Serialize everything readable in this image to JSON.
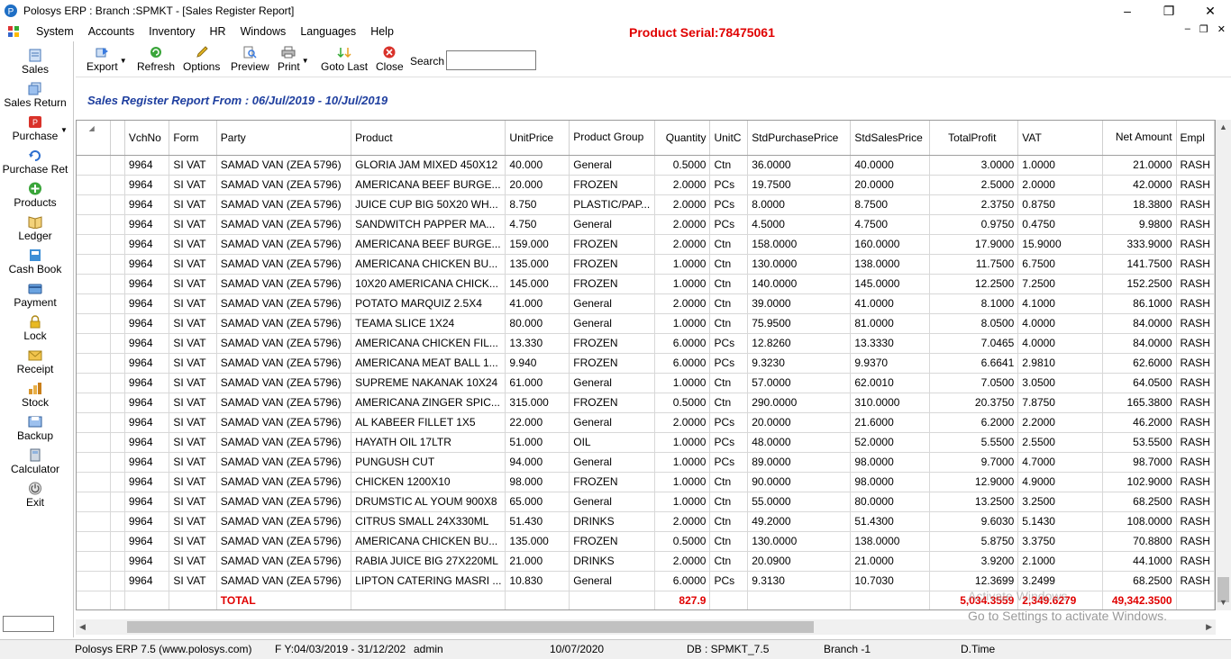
{
  "window": {
    "title": "Polosys ERP :  Branch :SPMKT  - [Sales Register Report]",
    "minimize": "–",
    "restore": "❐",
    "close": "✕"
  },
  "menu": [
    "System",
    "Accounts",
    "Inventory",
    "HR",
    "Windows",
    "Languages",
    "Help"
  ],
  "product_serial": "Product Serial:78475061",
  "mdi_controls": [
    "–",
    "❐",
    "✕"
  ],
  "sidebar": [
    {
      "label": "Sales",
      "icon": "sales-icon"
    },
    {
      "label": "Sales Return",
      "icon": "sales-return-icon"
    },
    {
      "label": "Purchase",
      "icon": "purchase-icon"
    },
    {
      "label": "Purchase Ret",
      "icon": "purchase-return-icon"
    },
    {
      "label": "Products",
      "icon": "products-icon"
    },
    {
      "label": "Ledger",
      "icon": "ledger-icon"
    },
    {
      "label": "Cash Book",
      "icon": "cash-book-icon"
    },
    {
      "label": "Payment",
      "icon": "payment-icon"
    },
    {
      "label": "Lock",
      "icon": "lock-icon"
    },
    {
      "label": "Receipt",
      "icon": "receipt-icon"
    },
    {
      "label": "Stock",
      "icon": "stock-icon"
    },
    {
      "label": "Backup",
      "icon": "backup-icon"
    },
    {
      "label": "Calculator",
      "icon": "calculator-icon"
    },
    {
      "label": "Exit",
      "icon": "exit-icon"
    }
  ],
  "toolbar": {
    "export": "Export",
    "refresh": "Refresh",
    "options": "Options",
    "preview": "Preview",
    "print": "Print",
    "goto_last": "Goto Last",
    "close": "Close",
    "search_label": "Search",
    "search_value": ""
  },
  "report_title": "Sales Register Report  From : 06/Jul/2019 - 10/Jul/2019",
  "columns": [
    "",
    "",
    "VchNo",
    "Form",
    "Party",
    "Product",
    "UnitPrice",
    "Product Group",
    "Quantity",
    "UnitC",
    "StdPurchasePrice",
    "StdSalesPrice",
    "TotalProfit",
    "VAT",
    "Net Amount",
    "Empl"
  ],
  "rows": [
    [
      "9964",
      "SI VAT",
      "SAMAD VAN (ZEA 5796)",
      "GLORIA JAM MIXED 450X12",
      "40.000",
      "General",
      "0.5000",
      "Ctn",
      "36.0000",
      "40.0000",
      "3.0000",
      "1.0000",
      "21.0000",
      "RASH"
    ],
    [
      "9964",
      "SI VAT",
      "SAMAD VAN (ZEA 5796)",
      "AMERICANA BEEF BURGE...",
      "20.000",
      "FROZEN",
      "2.0000",
      "PCs",
      "19.7500",
      "20.0000",
      "2.5000",
      "2.0000",
      "42.0000",
      "RASH"
    ],
    [
      "9964",
      "SI VAT",
      "SAMAD VAN (ZEA 5796)",
      "JUICE CUP BIG 50X20 WH...",
      "8.750",
      "PLASTIC/PAP...",
      "2.0000",
      "PCs",
      "8.0000",
      "8.7500",
      "2.3750",
      "0.8750",
      "18.3800",
      "RASH"
    ],
    [
      "9964",
      "SI VAT",
      "SAMAD VAN (ZEA 5796)",
      "SANDWITCH PAPPER MA...",
      "4.750",
      "General",
      "2.0000",
      "PCs",
      "4.5000",
      "4.7500",
      "0.9750",
      "0.4750",
      "9.9800",
      "RASH"
    ],
    [
      "9964",
      "SI VAT",
      "SAMAD VAN (ZEA 5796)",
      "AMERICANA BEEF BURGE...",
      "159.000",
      "FROZEN",
      "2.0000",
      "Ctn",
      "158.0000",
      "160.0000",
      "17.9000",
      "15.9000",
      "333.9000",
      "RASH"
    ],
    [
      "9964",
      "SI VAT",
      "SAMAD VAN (ZEA 5796)",
      "AMERICANA CHICKEN BU...",
      "135.000",
      "FROZEN",
      "1.0000",
      "Ctn",
      "130.0000",
      "138.0000",
      "11.7500",
      "6.7500",
      "141.7500",
      "RASH"
    ],
    [
      "9964",
      "SI VAT",
      "SAMAD VAN (ZEA 5796)",
      "10X20 AMERICANA CHICK...",
      "145.000",
      "FROZEN",
      "1.0000",
      "Ctn",
      "140.0000",
      "145.0000",
      "12.2500",
      "7.2500",
      "152.2500",
      "RASH"
    ],
    [
      "9964",
      "SI VAT",
      "SAMAD VAN (ZEA 5796)",
      "POTATO MARQUIZ 2.5X4",
      "41.000",
      "General",
      "2.0000",
      "Ctn",
      "39.0000",
      "41.0000",
      "8.1000",
      "4.1000",
      "86.1000",
      "RASH"
    ],
    [
      "9964",
      "SI VAT",
      "SAMAD VAN (ZEA 5796)",
      "TEAMA SLICE 1X24",
      "80.000",
      "General",
      "1.0000",
      "Ctn",
      "75.9500",
      "81.0000",
      "8.0500",
      "4.0000",
      "84.0000",
      "RASH"
    ],
    [
      "9964",
      "SI VAT",
      "SAMAD VAN (ZEA 5796)",
      "AMERICANA CHICKEN FIL...",
      "13.330",
      "FROZEN",
      "6.0000",
      "PCs",
      "12.8260",
      "13.3330",
      "7.0465",
      "4.0000",
      "84.0000",
      "RASH"
    ],
    [
      "9964",
      "SI VAT",
      "SAMAD VAN (ZEA 5796)",
      "AMERICANA MEAT BALL 1...",
      "9.940",
      "FROZEN",
      "6.0000",
      "PCs",
      "9.3230",
      "9.9370",
      "6.6641",
      "2.9810",
      "62.6000",
      "RASH"
    ],
    [
      "9964",
      "SI VAT",
      "SAMAD VAN (ZEA 5796)",
      "SUPREME NAKANAK 10X24",
      "61.000",
      "General",
      "1.0000",
      "Ctn",
      "57.0000",
      "62.0010",
      "7.0500",
      "3.0500",
      "64.0500",
      "RASH"
    ],
    [
      "9964",
      "SI VAT",
      "SAMAD VAN (ZEA 5796)",
      "AMERICANA ZINGER SPIC...",
      "315.000",
      "FROZEN",
      "0.5000",
      "Ctn",
      "290.0000",
      "310.0000",
      "20.3750",
      "7.8750",
      "165.3800",
      "RASH"
    ],
    [
      "9964",
      "SI VAT",
      "SAMAD VAN (ZEA 5796)",
      "AL KABEER FILLET 1X5",
      "22.000",
      "General",
      "2.0000",
      "PCs",
      "20.0000",
      "21.6000",
      "6.2000",
      "2.2000",
      "46.2000",
      "RASH"
    ],
    [
      "9964",
      "SI VAT",
      "SAMAD VAN (ZEA 5796)",
      "HAYATH OIL 17LTR",
      "51.000",
      "OIL",
      "1.0000",
      "PCs",
      "48.0000",
      "52.0000",
      "5.5500",
      "2.5500",
      "53.5500",
      "RASH"
    ],
    [
      "9964",
      "SI VAT",
      "SAMAD VAN (ZEA 5796)",
      "PUNGUSH CUT",
      "94.000",
      "General",
      "1.0000",
      "PCs",
      "89.0000",
      "98.0000",
      "9.7000",
      "4.7000",
      "98.7000",
      "RASH"
    ],
    [
      "9964",
      "SI VAT",
      "SAMAD VAN (ZEA 5796)",
      "CHICKEN 1200X10",
      "98.000",
      "FROZEN",
      "1.0000",
      "Ctn",
      "90.0000",
      "98.0000",
      "12.9000",
      "4.9000",
      "102.9000",
      "RASH"
    ],
    [
      "9964",
      "SI VAT",
      "SAMAD VAN (ZEA 5796)",
      "DRUMSTIC AL YOUM 900X8",
      "65.000",
      "General",
      "1.0000",
      "Ctn",
      "55.0000",
      "80.0000",
      "13.2500",
      "3.2500",
      "68.2500",
      "RASH"
    ],
    [
      "9964",
      "SI VAT",
      "SAMAD VAN (ZEA 5796)",
      "CITRUS SMALL 24X330ML",
      "51.430",
      "DRINKS",
      "2.0000",
      "Ctn",
      "49.2000",
      "51.4300",
      "9.6030",
      "5.1430",
      "108.0000",
      "RASH"
    ],
    [
      "9964",
      "SI VAT",
      "SAMAD VAN (ZEA 5796)",
      "AMERICANA CHICKEN BU...",
      "135.000",
      "FROZEN",
      "0.5000",
      "Ctn",
      "130.0000",
      "138.0000",
      "5.8750",
      "3.3750",
      "70.8800",
      "RASH"
    ],
    [
      "9964",
      "SI VAT",
      "SAMAD VAN (ZEA 5796)",
      "RABIA JUICE BIG 27X220ML",
      "21.000",
      "DRINKS",
      "2.0000",
      "Ctn",
      "20.0900",
      "21.0000",
      "3.9200",
      "2.1000",
      "44.1000",
      "RASH"
    ],
    [
      "9964",
      "SI VAT",
      "SAMAD VAN (ZEA 5796)",
      "LIPTON CATERING MASRI ...",
      "10.830",
      "General",
      "6.0000",
      "PCs",
      "9.3130",
      "10.7030",
      "12.3699",
      "3.2499",
      "68.2500",
      "RASH"
    ]
  ],
  "totals": {
    "label": "TOTAL",
    "quantity": "827.9",
    "total_profit": "5,034.3559",
    "vat": "2,349.6279",
    "net_amount": "49,342.3500"
  },
  "watermark": {
    "line1": "Activate Windows",
    "line2": "Go to Settings to activate Windows."
  },
  "status": {
    "app": "Polosys ERP 7.5  (www.polosys.com)",
    "fy": "F Y:04/03/2019 - 31/12/202",
    "user": "admin",
    "date": "10/07/2020",
    "db": "DB : SPMKT_7.5",
    "branch": "Branch -1",
    "time": "D.Time"
  }
}
